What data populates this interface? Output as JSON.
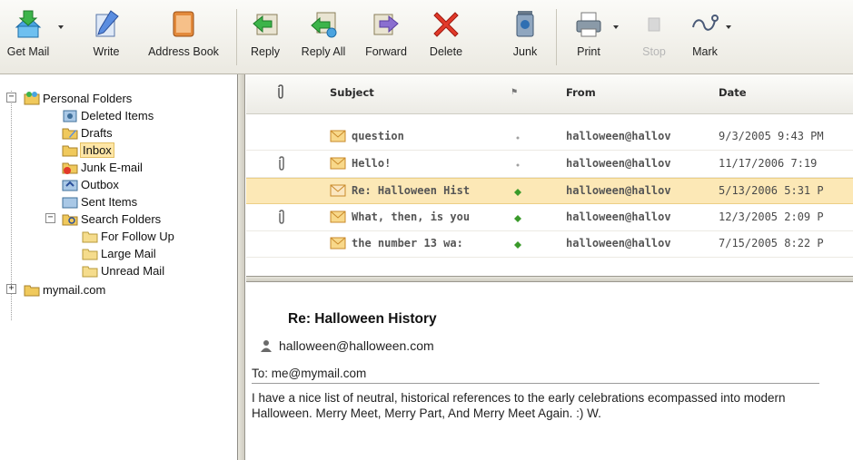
{
  "toolbar": {
    "buttons": [
      {
        "label": "Get Mail",
        "icon": "get-mail-icon"
      },
      {
        "label": "Write",
        "icon": "write-icon"
      },
      {
        "label": "Address Book",
        "icon": "address-book-icon"
      },
      {
        "label": "Reply",
        "icon": "reply-icon"
      },
      {
        "label": "Reply All",
        "icon": "reply-all-icon"
      },
      {
        "label": "Forward",
        "icon": "forward-icon"
      },
      {
        "label": "Delete",
        "icon": "delete-icon"
      },
      {
        "label": "Junk",
        "icon": "junk-icon"
      },
      {
        "label": "Print",
        "icon": "printer-icon"
      },
      {
        "label": "Stop",
        "icon": "stop-icon",
        "disabled": true
      },
      {
        "label": "Mark",
        "icon": "mark-icon"
      }
    ]
  },
  "folders": {
    "root": "Personal Folders",
    "items": [
      "Deleted Items",
      "Drafts",
      "Inbox",
      "Junk E-mail",
      "Outbox",
      "Sent Items"
    ],
    "search_root": "Search Folders",
    "search_items": [
      "For Follow Up",
      "Large Mail",
      "Unread Mail"
    ],
    "account": "mymail.com",
    "selected": "Inbox"
  },
  "message_list": {
    "columns": {
      "subject": "Subject",
      "flag": "⚑",
      "from": "From",
      "date": "Date"
    },
    "rows": [
      {
        "subject": "question",
        "from": "halloween@hallov",
        "date": "9/3/2005 9:43 PM",
        "attachment": false,
        "flag_color": "#a0a0a0"
      },
      {
        "subject": "Hello!",
        "from": "halloween@hallov",
        "date": "11/17/2006 7:19",
        "attachment": true,
        "flag_color": "#a0a0a0"
      },
      {
        "subject": "Re: Halloween Hist",
        "from": "halloween@hallov",
        "date": "5/13/2006 5:31 P",
        "attachment": false,
        "flag_color": "#3a9a2a"
      },
      {
        "subject": "What, then, is you",
        "from": "halloween@hallov",
        "date": "12/3/2005 2:09 P",
        "attachment": true,
        "flag_color": "#3a9a2a"
      },
      {
        "subject": "the number 13 wa:",
        "from": "halloween@hallov",
        "date": "7/15/2005 8:22 P",
        "attachment": false,
        "flag_color": "#3a9a2a"
      }
    ]
  },
  "reading_pane": {
    "subject": "Re: Halloween History",
    "from": "halloween@halloween.com",
    "to": "To: me@mymail.com",
    "body": "I have a nice list of neutral, historical references to the early celebrations ecompassed into modern Halloween. Merry Meet, Merry Part, And Merry Meet Again. :) W."
  },
  "colors": {
    "selected_row": "#fce8b6",
    "selected_folder": "#ffe6a6",
    "flag_green": "#3a9a2a"
  }
}
